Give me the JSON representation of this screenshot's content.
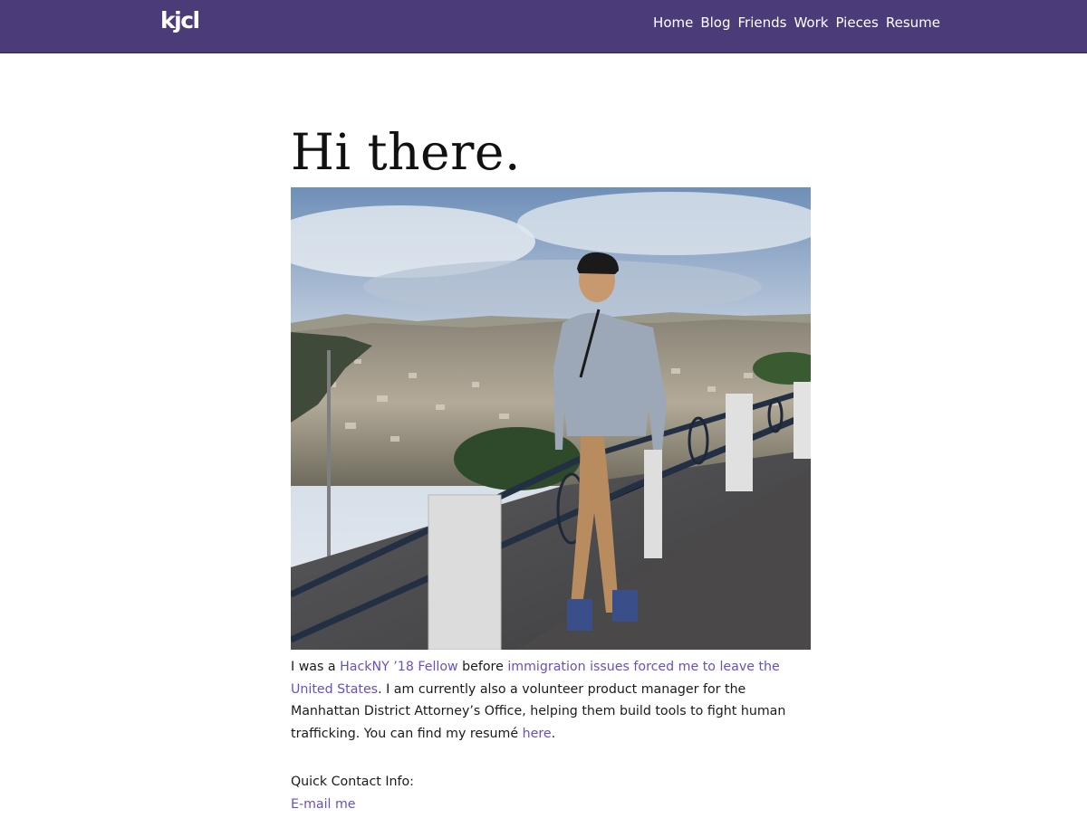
{
  "site": {
    "logo": "kjcl"
  },
  "nav": {
    "items": [
      {
        "label": "Home"
      },
      {
        "label": "Blog"
      },
      {
        "label": "Friends"
      },
      {
        "label": "Work"
      },
      {
        "label": "Pieces"
      },
      {
        "label": "Resume"
      }
    ]
  },
  "main": {
    "title": "Hi there.",
    "bio": {
      "t1": "I was a ",
      "link1": "HackNY ’18 Fellow",
      "t2": " before ",
      "link2": "immigration issues forced me to leave the United States",
      "t3": ". I am currently also a volunteer product manager for the Manhattan District Attorney’s Office, helping them build tools to fight human trafficking. You can find my resumé ",
      "link3": "here",
      "t4": "."
    },
    "contact": {
      "heading": "Quick Contact Info:",
      "email_link": "E-mail me"
    }
  },
  "colors": {
    "navbar": "#4b3b78",
    "link": "#6a4fc0",
    "text": "#1a1a1a"
  }
}
